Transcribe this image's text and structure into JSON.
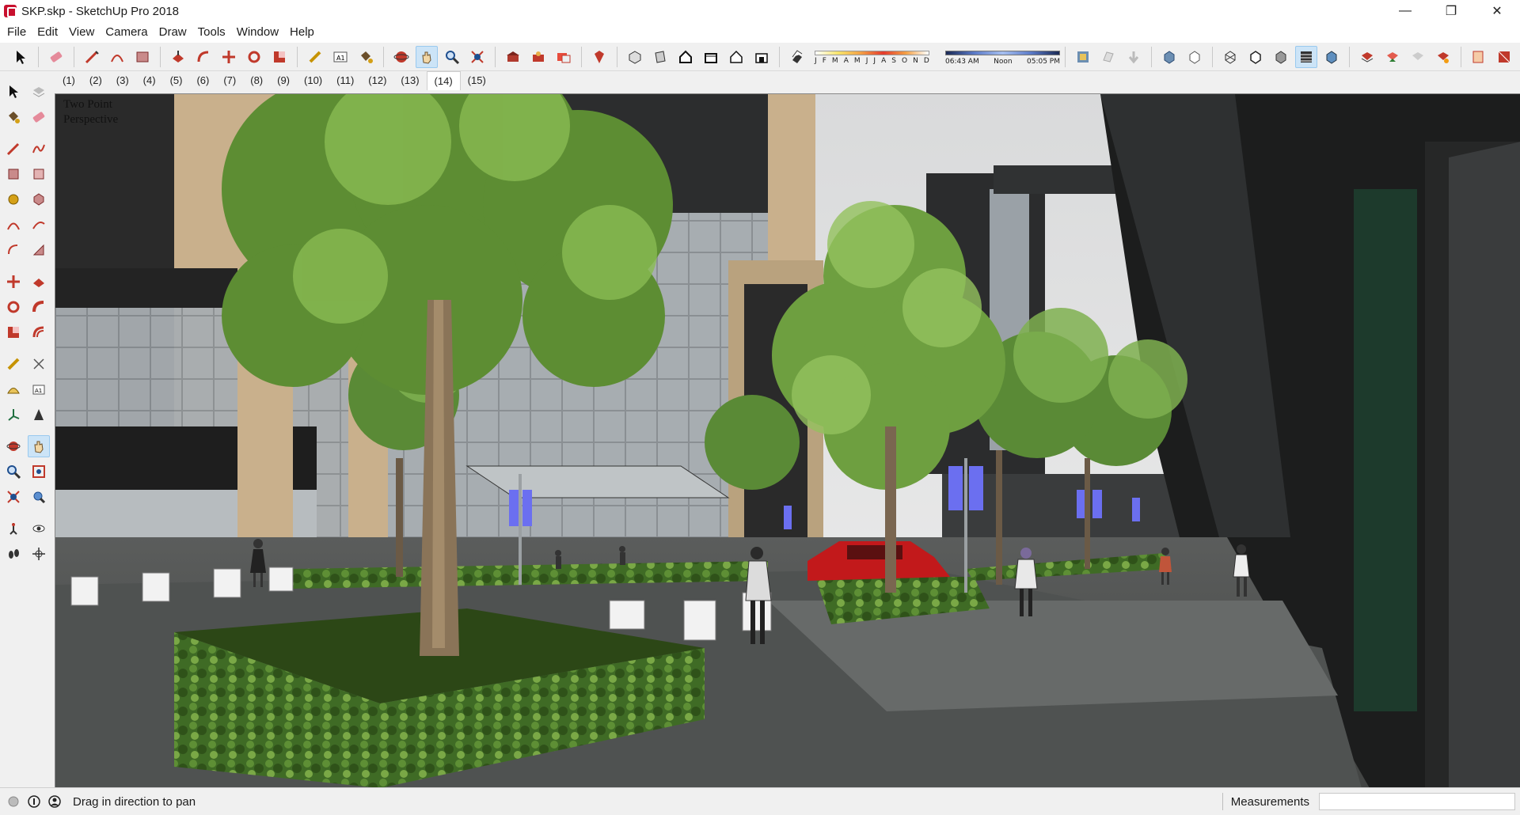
{
  "window": {
    "title": "SKP.skp - SketchUp Pro 2018",
    "controls": {
      "minimize": "—",
      "restore": "❐",
      "close": "✕"
    }
  },
  "menu": [
    "File",
    "Edit",
    "View",
    "Camera",
    "Draw",
    "Tools",
    "Window",
    "Help"
  ],
  "toolbar": {
    "shadow_months": [
      "J",
      "F",
      "M",
      "A",
      "M",
      "J",
      "J",
      "A",
      "S",
      "O",
      "N",
      "D"
    ],
    "shadow_time": {
      "start": "06:43 AM",
      "mid": "Noon",
      "end": "05:05 PM"
    }
  },
  "scenes": {
    "tabs": [
      "(1)",
      "(2)",
      "(3)",
      "(4)",
      "(5)",
      "(6)",
      "(7)",
      "(8)",
      "(9)",
      "(10)",
      "(11)",
      "(12)",
      "(13)",
      "(14)",
      "(15)"
    ],
    "active_index": 13
  },
  "viewport": {
    "camera_label_line1": "Two Point",
    "camera_label_line2": "Perspective"
  },
  "status": {
    "hint": "Drag in direction to pan",
    "measurements_label": "Measurements",
    "measurements_value": ""
  },
  "colors": {
    "accent_selected": "#cce4f7",
    "app_red": "#c8102e"
  }
}
